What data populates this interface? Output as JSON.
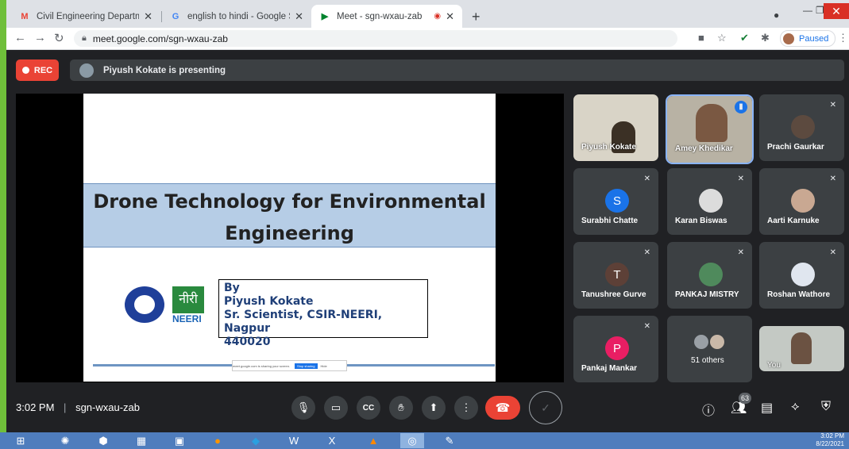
{
  "browser": {
    "tabs": [
      {
        "title": "Civil Engineering Department or",
        "icon": "gmail-icon"
      },
      {
        "title": "english to hindi - Google Search",
        "icon": "google-icon"
      },
      {
        "title": "Meet - sgn-wxau-zab",
        "icon": "meet-icon",
        "active": true
      }
    ],
    "new_tab": "+",
    "url": "meet.google.com/sgn-wxau-zab",
    "profile_status": "Paused"
  },
  "meet": {
    "rec_label": "REC",
    "presenting_text": "Piyush Kokate is presenting",
    "slide": {
      "title_line1": "Drone Technology for Environmental",
      "title_line2": "Engineering",
      "logo_hindi": "नीरी",
      "logo_text": "NEERI",
      "by": "By",
      "author": "Piyush Kokate",
      "role": "Sr. Scientist, CSIR-NEERI, Nagpur",
      "pin": "440020",
      "share_notice_text": "meet.google.com is sharing your screen.",
      "stop_sharing": "Stop sharing",
      "hide": "Hide"
    },
    "participants": [
      {
        "name": "Piyush Kokate",
        "type": "video",
        "muted": false
      },
      {
        "name": "Amey Khedikar",
        "type": "video",
        "speaking": true
      },
      {
        "name": "Prachi Gaurkar",
        "type": "avatar-photo",
        "muted": true
      },
      {
        "name": "Surabhi Chatte",
        "type": "initial",
        "initial": "S",
        "color": "#1a73e8",
        "muted": true
      },
      {
        "name": "Karan Biswas",
        "type": "avatar-photo",
        "muted": true
      },
      {
        "name": "Aarti Karnuke",
        "type": "avatar-photo",
        "muted": true
      },
      {
        "name": "Tanushree Gurve",
        "type": "initial",
        "initial": "T",
        "color": "#5d4037",
        "muted": true
      },
      {
        "name": "PANKAJ MISTRY",
        "type": "avatar-photo",
        "muted": true
      },
      {
        "name": "Roshan Wathore",
        "type": "avatar-photo",
        "muted": true
      },
      {
        "name": "Pankaj Mankar",
        "type": "initial",
        "initial": "P",
        "color": "#e91e63",
        "muted": true
      },
      {
        "name": "51 others",
        "type": "group"
      },
      {
        "name": "You",
        "type": "video"
      }
    ],
    "bottom": {
      "time": "3:02 PM",
      "meeting_code": "sgn-wxau-zab",
      "people_count": "63"
    }
  },
  "taskbar": {
    "time": "3:02 PM",
    "date": "8/22/2021"
  },
  "colors": {
    "meet_bg": "#202124",
    "tile_bg": "#3c4043",
    "rec_red": "#ea4335",
    "speaking_outline": "#8ab4f8"
  }
}
